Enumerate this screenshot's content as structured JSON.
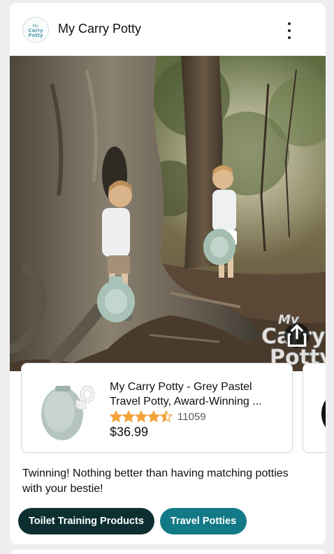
{
  "post": {
    "brand_name": "My Carry Potty",
    "logo_text": "My Carry Potty",
    "menu_icon": "more-vertical-icon",
    "share_icon": "share-icon",
    "photo_watermark": "My Carry Potty",
    "caption": "Twinning! Nothing better than having matching potties with your bestie!"
  },
  "product": {
    "title_line1": "My Carry Potty - Grey Pastel",
    "title_line2": "Travel Potty, Award-Winning ...",
    "rating": 4.5,
    "review_count": "11059",
    "price": "$36.99",
    "star_color": "#f2a33a"
  },
  "tags": [
    {
      "label": "Toilet Training Products",
      "color": "#0d2f32"
    },
    {
      "label": "Travel Potties",
      "color": "#127a86"
    }
  ]
}
